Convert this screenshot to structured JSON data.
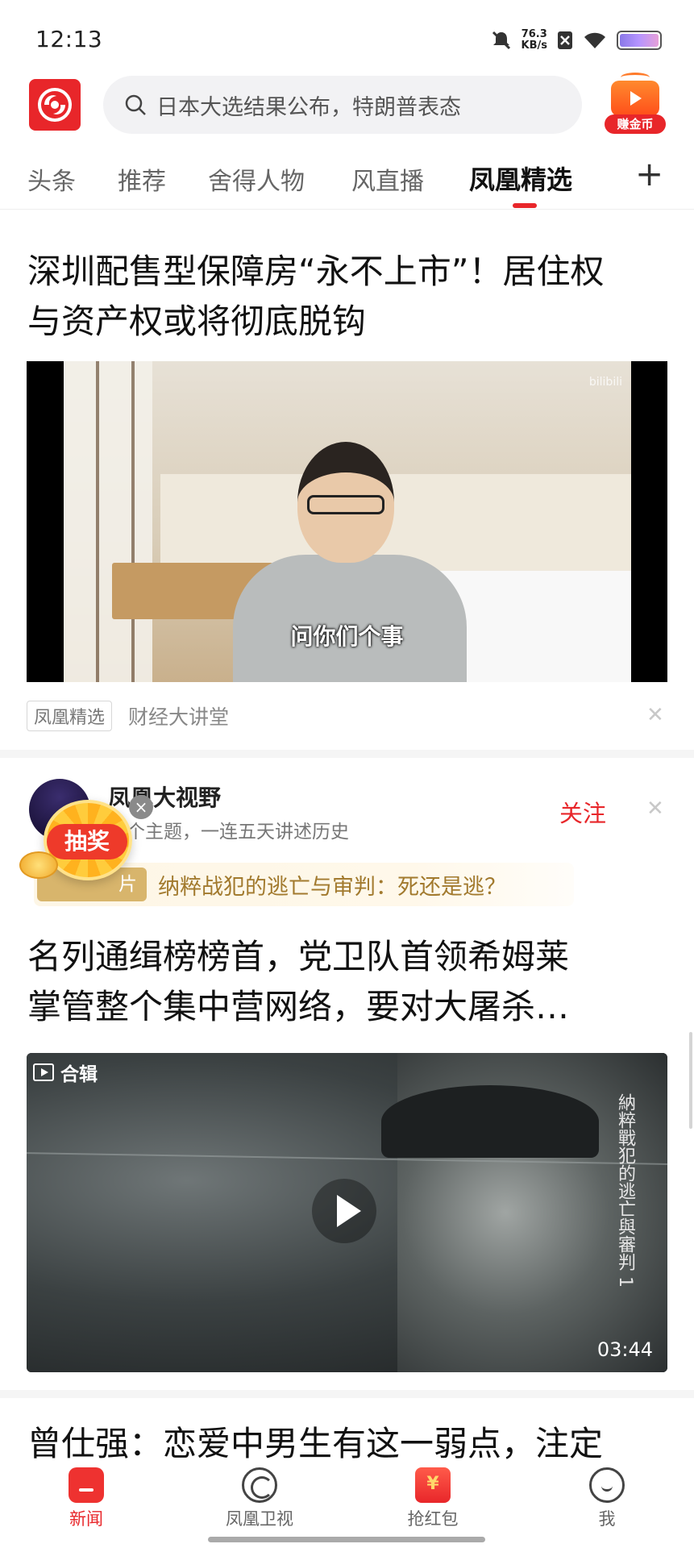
{
  "status_bar": {
    "time": "12:13",
    "net_speed_value": "76.3",
    "net_speed_unit": "KB/s",
    "icons": [
      "mute-icon",
      "sim-off-icon",
      "wifi-icon",
      "battery-icon"
    ]
  },
  "header": {
    "logo_icon": "phoenix-logo-icon",
    "search_placeholder": "日本大选结果公布，特朗普表态",
    "coin_button_label": "赚金币",
    "brand_color": "#e8262a"
  },
  "tabs": {
    "items": [
      "头条",
      "推荐",
      "舍得人物",
      "风直播",
      "凤凰精选"
    ],
    "active": "凤凰精选",
    "add_icon": "plus-icon"
  },
  "feed": {
    "article1": {
      "title_line1": "深圳配售型保障房“永不上市”！居住权",
      "title_line2": "与资产权或将彻底脱钩",
      "video_subtitle": "问你们个事",
      "watermark": "bilibili",
      "tag": "凤凰精选",
      "source": "财经大讲堂"
    },
    "article2": {
      "author_name": "凤凰大视野",
      "author_desc": "一个主题，一连五天讲述历史",
      "follow_label": "关注",
      "series_pill": "片",
      "series_title": "纳粹战犯的逃亡与审判：死还是逃？",
      "title_line1": "名列通缉榜榜首，党卫队首领希姆莱",
      "title_line2": "掌管整个集中营网络，要对大屠杀…",
      "collection_label": "合辑",
      "video_vertical_title": "納粹戰犯的逃亡與審判 1",
      "duration": "03:44"
    },
    "article3": {
      "title_line1": "曾仕强：恋爱中男生有这一弱点，注定"
    }
  },
  "floating_lottery": {
    "label": "抽奖",
    "close_symbol": "×"
  },
  "bottom_nav": {
    "items": [
      {
        "label": "新闻",
        "icon": "news-icon",
        "active": true
      },
      {
        "label": "凤凰卫视",
        "icon": "phoenix-tv-icon",
        "active": false
      },
      {
        "label": "抢红包",
        "icon": "red-packet-icon",
        "active": false
      },
      {
        "label": "我",
        "icon": "profile-icon",
        "active": false
      }
    ]
  }
}
